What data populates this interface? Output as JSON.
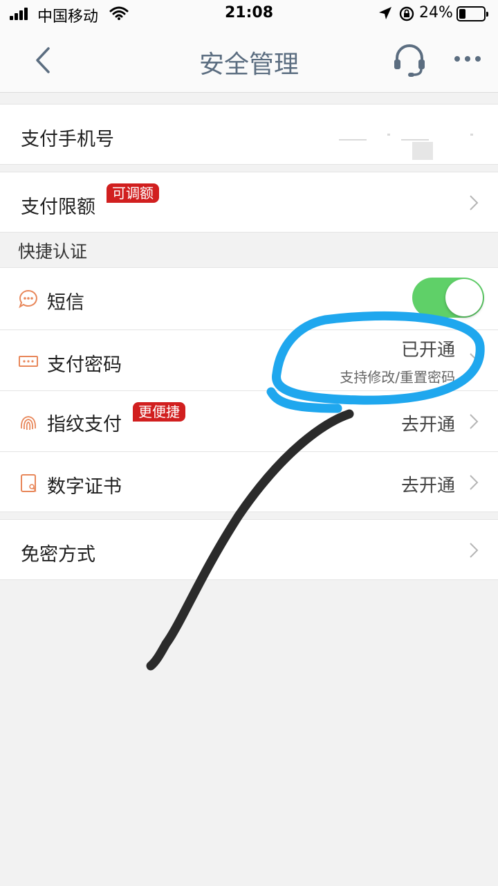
{
  "status_bar": {
    "carrier": "中国移动",
    "time": "21:08",
    "battery_percent": "24%",
    "battery_level": 0.24,
    "icons": [
      "signal-icon",
      "wifi-icon",
      "location-arrow-icon",
      "rotation-lock-icon",
      "battery-icon"
    ]
  },
  "nav": {
    "title": "安全管理",
    "icons": [
      "back-chevron-icon",
      "headset-icon",
      "more-dots-icon"
    ]
  },
  "rows": {
    "phone": {
      "label": "支付手机号"
    },
    "limit": {
      "label": "支付限额",
      "tag": "可调额"
    },
    "section_title": "快捷认证",
    "sms": {
      "label": "短信",
      "icon": "chat-bubble-icon",
      "enabled": true
    },
    "password": {
      "label": "支付密码",
      "icon": "password-field-icon",
      "value": "已开通",
      "sub": "支持修改/重置密码"
    },
    "fingerprint": {
      "label": "指纹支付",
      "icon": "fingerprint-icon",
      "tag": "更便捷",
      "value": "去开通"
    },
    "certificate": {
      "label": "数字证书",
      "icon": "certificate-icon",
      "value": "去开通"
    },
    "nopass": {
      "label": "免密方式"
    }
  },
  "colors": {
    "accent_tag": "#d11f1f",
    "toggle_on": "#5fd068",
    "icon_orange": "#e8875a",
    "title_gray": "#5b6d80",
    "annotation_circle": "#1fa7ee",
    "annotation_arrow": "#2b2b2b"
  }
}
